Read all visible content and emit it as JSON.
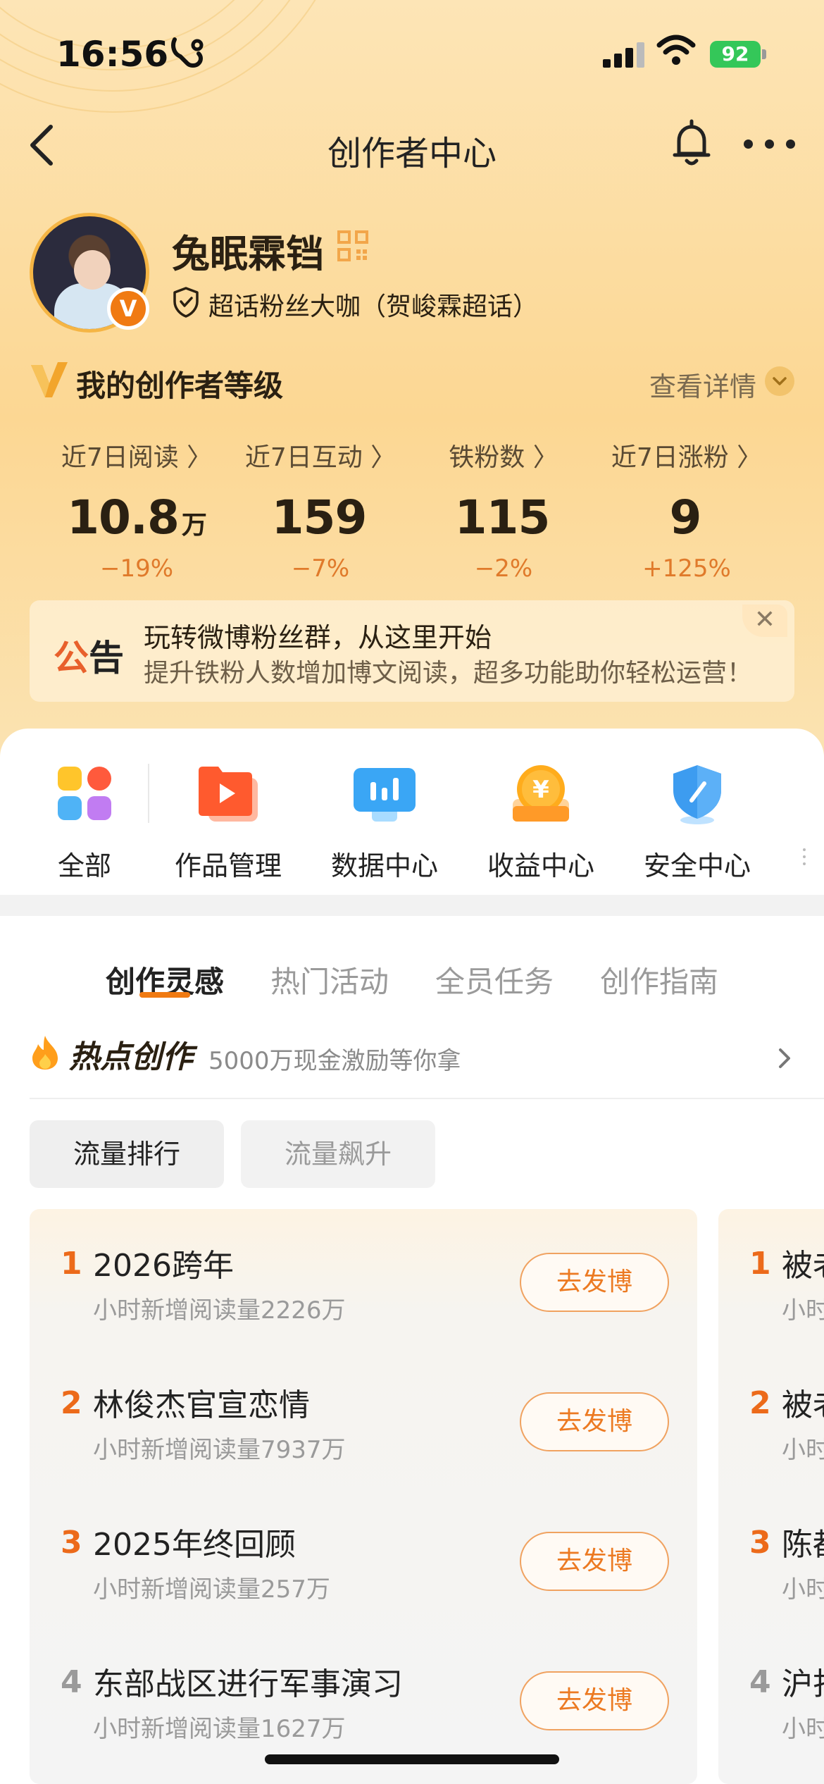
{
  "status_bar": {
    "time": "16:56",
    "battery": "92"
  },
  "nav": {
    "title": "创作者中心"
  },
  "profile": {
    "username": "兔眠霖铛",
    "fan_badge": "超话粉丝大咖（贺峻霖超话）"
  },
  "level": {
    "title": "我的创作者等级",
    "detail_label": "查看详情"
  },
  "stats": [
    {
      "label": "近7日阅读 〉",
      "value": "10.8",
      "unit": "万",
      "change": "−19%"
    },
    {
      "label": "近7日互动 〉",
      "value": "159",
      "unit": "",
      "change": "−7%"
    },
    {
      "label": "铁粉数 〉",
      "value": "115",
      "unit": "",
      "change": "−2%"
    },
    {
      "label": "近7日涨粉 〉",
      "value": "9",
      "unit": "",
      "change": "+125%"
    }
  ],
  "notice": {
    "tag_a": "公",
    "tag_b": "告",
    "title": "玩转微博粉丝群，从这里开始",
    "subtitle": "提升铁粉人数增加博文阅读，超多功能助你轻松运营！"
  },
  "tools": [
    {
      "label": "全部",
      "icon": "grid-apps-icon"
    },
    {
      "label": "作品管理",
      "icon": "play-folder-icon"
    },
    {
      "label": "数据中心",
      "icon": "bar-chart-icon"
    },
    {
      "label": "收益中心",
      "icon": "yen-coin-icon"
    },
    {
      "label": "安全中心",
      "icon": "shield-icon"
    }
  ],
  "tabs": [
    "创作灵感",
    "热门活动",
    "全员任务",
    "创作指南"
  ],
  "hot": {
    "title": "热点创作",
    "subtitle": "5000万现金激励等你拿"
  },
  "filters": [
    "流量排行",
    "流量飙升"
  ],
  "list": [
    {
      "rank": "1",
      "title": "2026跨年",
      "sub": "小时新增阅读量2226万",
      "button": "去发博"
    },
    {
      "rank": "2",
      "title": "林俊杰官宣恋情",
      "sub": "小时新增阅读量7937万",
      "button": "去发博"
    },
    {
      "rank": "3",
      "title": "2025年终回顾",
      "sub": "小时新增阅读量257万",
      "button": "去发博"
    },
    {
      "rank": "4",
      "title": "东部战区进行军事演习",
      "sub": "小时新增阅读量1627万",
      "button": "去发博"
    }
  ],
  "list2": [
    {
      "rank": "1",
      "title": "被老",
      "sub": "小时"
    },
    {
      "rank": "2",
      "title": "被老",
      "sub": "小时"
    },
    {
      "rank": "3",
      "title": "陈都",
      "sub": "小时"
    },
    {
      "rank": "4",
      "title": "沪打",
      "sub": "小时"
    }
  ],
  "colors": {
    "accent": "#f07a12",
    "rank_top": "#ec6a1a",
    "rank_other": "#9a9a9a"
  }
}
